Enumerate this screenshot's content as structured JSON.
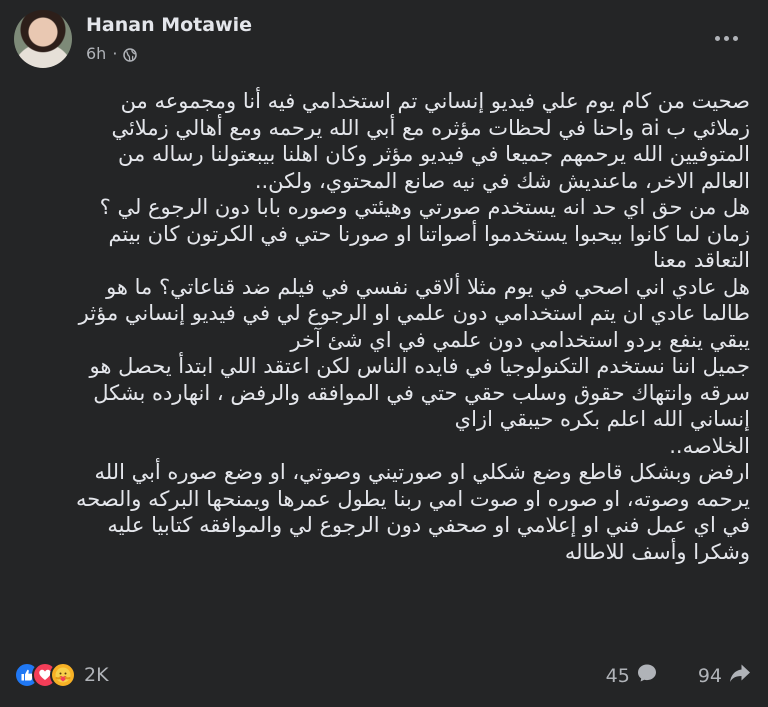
{
  "author": {
    "name": "Hanan Motawie",
    "time": "6h",
    "separator": "·"
  },
  "post_lines": [
    "صحيت من كام يوم علي فيديو إنساني تم استخدامي فيه أنا ومجموعه من",
    "زملائي ب ai واحنا في لحظات مؤثره مع أبي الله يرحمه ومع أهالي زملائي",
    "المتوفيين الله يرحمهم جميعا في فيديو مؤثر وكان اهلنا بيبعتولنا رساله من",
    "العالم الاخر، ماعنديش شك في نيه صانع المحتوي، ولكن..",
    "هل من حق اي حد انه يستخدم صورتي وهيئتي وصوره بابا دون الرجوع لي ؟",
    "زمان لما كانوا بيحبوا يستخدموا أصواتنا او صورنا حتي في الكرتون كان بيتم",
    "التعاقد معنا",
    "هل عادي اني اصحي في يوم مثلا ألاقي نفسي في فيلم ضد قناعاتي؟ ما هو",
    "طالما عادي ان يتم استخدامي دون علمي او الرجوع لي في فيديو إنساني مؤثر",
    "يبقي ينفع بردو استخدامي دون علمي في اي شئ آخر",
    "جميل اننا نستخدم التكنولوجيا في فايده الناس لكن اعتقد اللي ابتدأ يحصل هو",
    "سرقه وانتهاك حقوق وسلب حقي حتي في الموافقه والرفض ، انهارده بشكل",
    "إنساني الله اعلم بكره حيبقي ازاي",
    "الخلاصه..",
    "ارفض وبشكل قاطع وضع شكلي او صورتيني وصوتي، او  وضع صوره أبي الله",
    "يرحمه وصوته، او صوره او صوت امي ربنا يطول عمرها ويمنحها البركه والصحه",
    "في اي عمل  فني او إعلامي او صحفي دون الرجوع لي والموافقه كتابيا عليه",
    "وشكرا وأسف للاطاله"
  ],
  "footer": {
    "reaction_count": "2K",
    "comments_count": "45",
    "shares_count": "94"
  },
  "colors": {
    "background": "#242526",
    "text": "#e4e6eb",
    "muted": "#b0b3b8",
    "like": "#2078f4",
    "love": "#f33e58",
    "care": "#f7b125"
  }
}
